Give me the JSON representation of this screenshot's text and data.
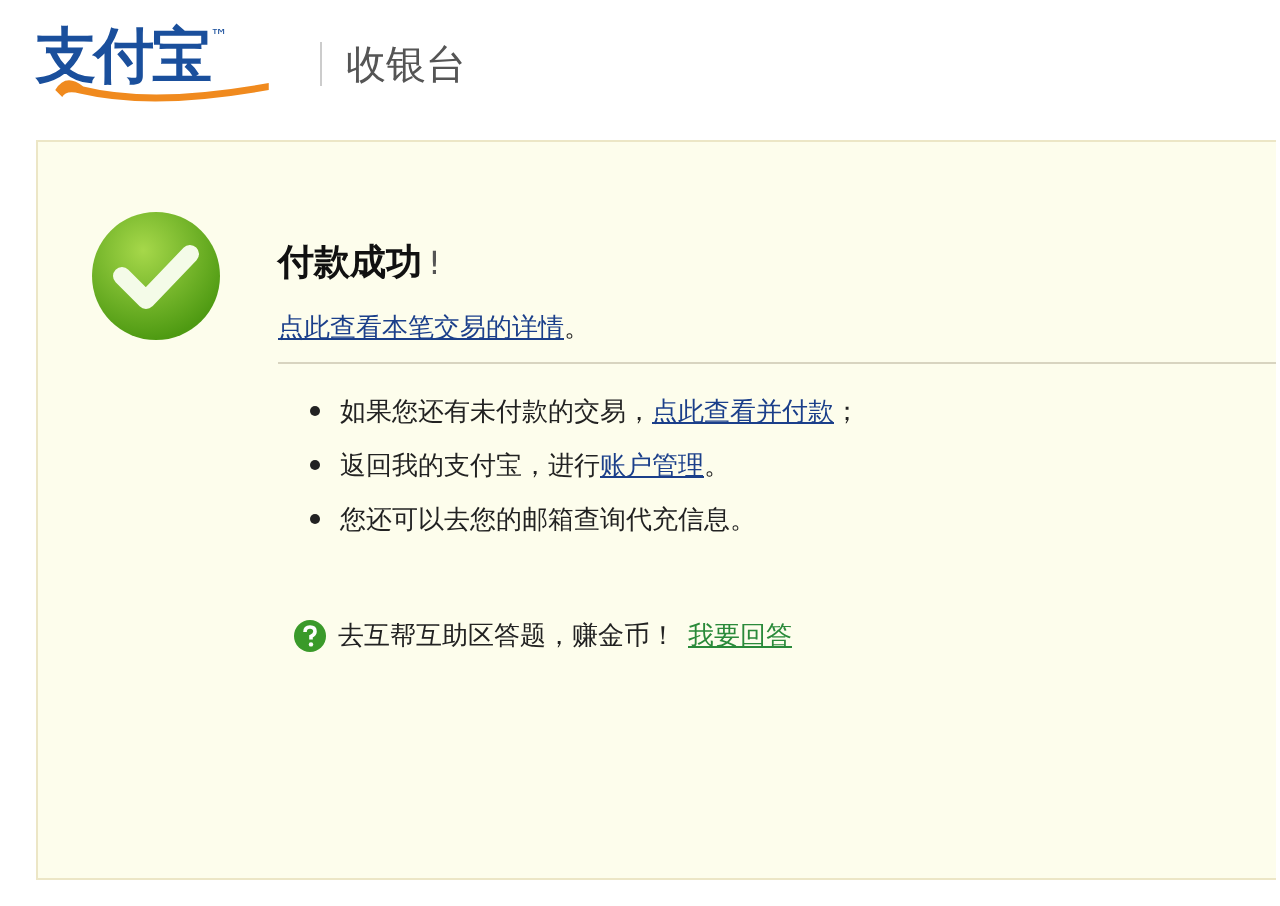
{
  "header": {
    "logo": "支付宝",
    "trademark": "™",
    "title": "收银台"
  },
  "result": {
    "title": "付款成功",
    "exclaim": "!",
    "detail_link": "点此查看本笔交易的详情",
    "detail_after": "。"
  },
  "notes": [
    {
      "parts": [
        {
          "kind": "text",
          "text": "如果您还有未付款的交易，"
        },
        {
          "kind": "link",
          "text": "点此查看并付款"
        },
        {
          "kind": "text",
          "text": "；"
        }
      ]
    },
    {
      "parts": [
        {
          "kind": "text",
          "text": "返回我的支付宝，进行"
        },
        {
          "kind": "link",
          "text": "账户管理"
        },
        {
          "kind": "text",
          "text": "。"
        }
      ]
    },
    {
      "parts": [
        {
          "kind": "text",
          "text": "您还可以去您的邮箱查询代充信息。"
        }
      ]
    }
  ],
  "help": {
    "text": "去互帮互助区答题，赚金币！",
    "link": "我要回答"
  }
}
